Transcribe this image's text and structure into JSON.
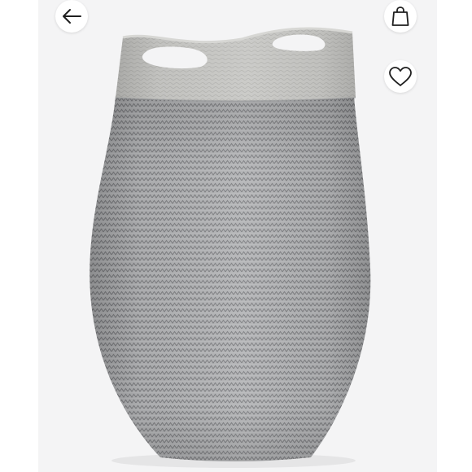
{
  "screen": {
    "background": "#ffffff",
    "photo_background": "#f4f4f5"
  },
  "header": {
    "back_icon": "arrow-left-icon",
    "bag_icon": "shopping-bag-icon",
    "wishlist_icon": "heart-outline-icon"
  },
  "product": {
    "image": "grey-woven-laundry-basket",
    "basket_color": "#a9aaac",
    "rim_color": "#c4c4c1"
  }
}
